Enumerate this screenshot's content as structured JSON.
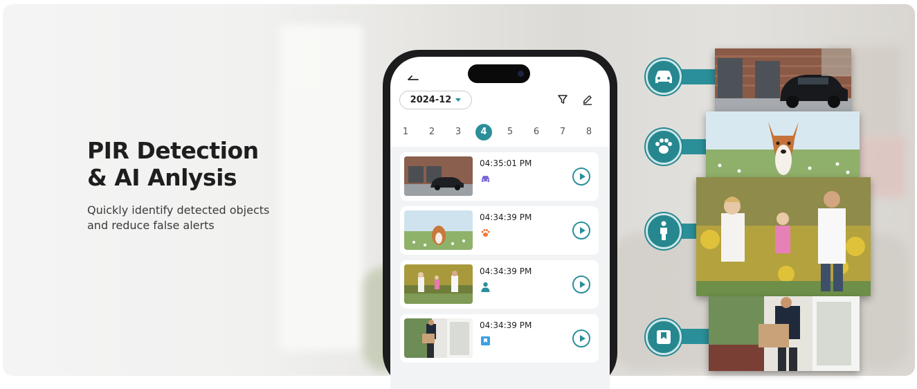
{
  "banner": {
    "headline_line1": "PIR Detection",
    "headline_line2": "& AI Anlysis",
    "subline_line1": "Quickly identify detected objects",
    "subline_line2": "and reduce false alerts"
  },
  "app": {
    "back_icon": "back-arrow-icon",
    "date_filter": {
      "value": "2024-12"
    },
    "toolbar_icons": [
      "filter-icon",
      "edit-icon"
    ],
    "days": [
      "1",
      "2",
      "3",
      "4",
      "5",
      "6",
      "7",
      "8"
    ],
    "selected_day": "4",
    "accent_color": "#2b8f9a",
    "events": [
      {
        "time": "04:35:01 PM",
        "type": "vehicle",
        "icon": "car-icon",
        "icon_color": "#7b68d8"
      },
      {
        "time": "04:34:39 PM",
        "type": "pet",
        "icon": "paw-icon",
        "icon_color": "#f07a3a"
      },
      {
        "time": "04:34:39 PM",
        "type": "person",
        "icon": "person-icon",
        "icon_color": "#2b8f9a"
      },
      {
        "time": "04:34:39 PM",
        "type": "package",
        "icon": "package-icon",
        "icon_color": "#3ba0e6"
      }
    ]
  },
  "detection_types": [
    {
      "icon": "car-icon",
      "photo": "car-parked-at-garage"
    },
    {
      "icon": "paw-icon",
      "photo": "dog-in-meadow"
    },
    {
      "icon": "person-icon",
      "photo": "family-playing-outdoors"
    },
    {
      "icon": "package-icon",
      "photo": "package-delivery-at-door"
    }
  ]
}
